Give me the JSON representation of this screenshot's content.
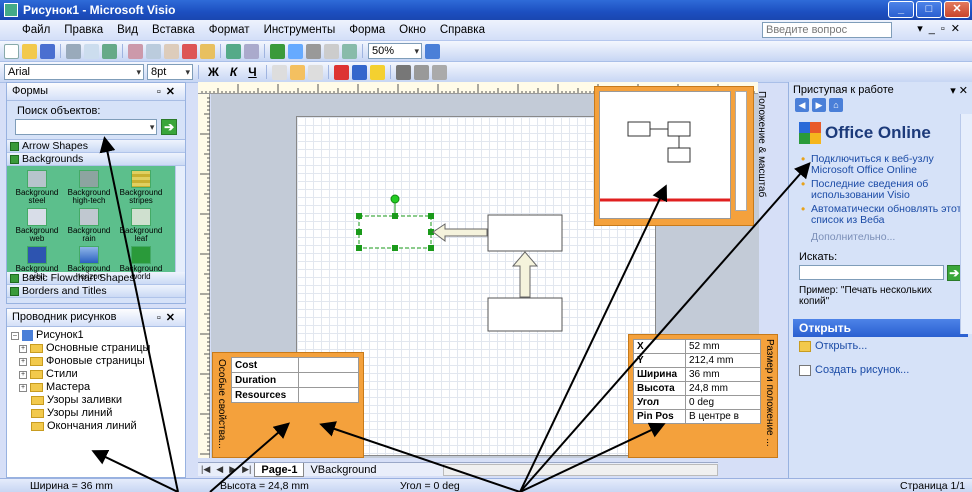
{
  "window": {
    "title": "Рисунок1 - Microsoft Visio"
  },
  "menu": {
    "items": [
      "Файл",
      "Правка",
      "Вид",
      "Вставка",
      "Формат",
      "Инструменты",
      "Форма",
      "Окно",
      "Справка"
    ],
    "ask_placeholder": "Введите вопрос"
  },
  "toolbar": {
    "zoom": "50%"
  },
  "format_toolbar": {
    "font": "Arial",
    "size": "8pt",
    "bold": "Ж",
    "italic": "К",
    "underline": "Ч"
  },
  "shapes_pane": {
    "title": "Формы",
    "search_label": "Поиск объектов:",
    "stencils": [
      "Arrow Shapes",
      "Backgrounds",
      "Basic Flowchart Shapes",
      "Borders and Titles"
    ],
    "items": [
      "Background steel",
      "Background high-tech",
      "Background stripes",
      "Background web",
      "Background rain",
      "Background leaf",
      "Background orbit",
      "Background horizon",
      "Background world"
    ]
  },
  "explorer": {
    "title": "Проводник рисунков",
    "root": "Рисунок1",
    "nodes": [
      "Основные страницы",
      "Фоновые страницы",
      "Стили",
      "Мастера",
      "Узоры заливки",
      "Узоры линий",
      "Окончания линий"
    ]
  },
  "page_tabs": [
    "Page-1",
    "VBackground"
  ],
  "pan_zoom": {
    "title": "Положение & масштаб"
  },
  "size_position": {
    "title": "Размер и положение ...",
    "rows": [
      {
        "k": "X",
        "v": "52 mm"
      },
      {
        "k": "Y",
        "v": "212,4 mm"
      },
      {
        "k": "Ширина",
        "v": "36 mm"
      },
      {
        "k": "Высота",
        "v": "24,8 mm"
      },
      {
        "k": "Угол",
        "v": "0 deg"
      },
      {
        "k": "Pin Pos",
        "v": "В центре в"
      }
    ]
  },
  "shape_data": {
    "title": "Особые свойства...",
    "rows": [
      "Cost",
      "Duration",
      "Resources"
    ]
  },
  "task_pane": {
    "title": "Приступая к работе",
    "brand": "Office Online",
    "links": [
      "Подключиться к веб-узлу Microsoft Office Online",
      "Последние сведения об использовании Visio",
      "Автоматически обновлять этот список из Веба"
    ],
    "more": "Дополнительно...",
    "search_label": "Искать:",
    "example_label": "Пример:",
    "example_text": "\"Печать нескольких копий\"",
    "open_section": "Открыть",
    "open_link": "Открыть...",
    "create_link": "Создать рисунок..."
  },
  "status": {
    "width": "Ширина = 36 mm",
    "height": "Высота = 24,8 mm",
    "angle": "Угол = 0 deg",
    "page": "Страница 1/1"
  },
  "colors": {
    "title_bar": "#1c4fc0",
    "shape_panel": "#5cbf8c",
    "floating_window": "#f4a13c",
    "selection_green": "#1a9a1a"
  }
}
